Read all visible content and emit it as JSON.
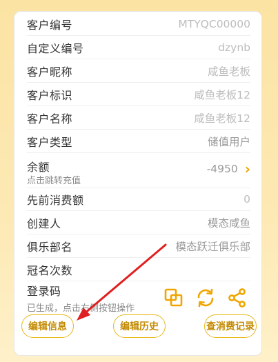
{
  "rows": [
    {
      "label": "客户编号",
      "value": "MTYQC00000"
    },
    {
      "label": "自定义编号",
      "value": "dzynb"
    },
    {
      "label": "客户昵称",
      "value": "咸鱼老板"
    },
    {
      "label": "客户标识",
      "value": "咸鱼老板12"
    },
    {
      "label": "客户名称",
      "value": "咸鱼老板12"
    },
    {
      "label": "客户类型",
      "value": "储值用户"
    }
  ],
  "balance": {
    "label": "余额",
    "value": "-4950",
    "hint": "点击跳转充值"
  },
  "rows2": [
    {
      "label": "先前消费额",
      "value": "0"
    },
    {
      "label": "创建人",
      "value": "模态咸鱼"
    },
    {
      "label": "俱乐部名",
      "value": "模态跃迁俱乐部"
    },
    {
      "label": "冠名次数",
      "value": ""
    }
  ],
  "login_code": {
    "label": "登录码",
    "hint": "已生成，点击右侧按钮操作"
  },
  "buttons": {
    "edit_info": "编辑信息",
    "edit_history": "编辑历史",
    "consumption_records": "查消费记录"
  },
  "colors": {
    "accent": "#f0a500",
    "arrow": "#e02020"
  }
}
